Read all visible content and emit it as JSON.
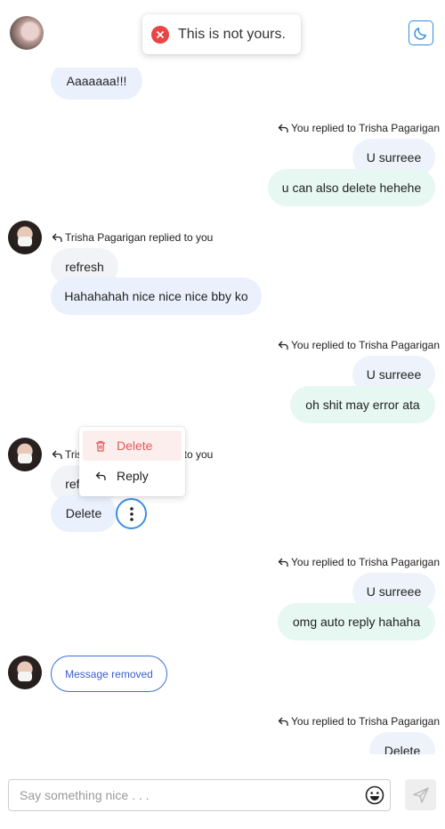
{
  "toast": {
    "text": "This is not yours."
  },
  "feed": {
    "top_partial_bubble": "Aaaaaaa!!!",
    "messages": [
      {
        "reply_meta": "You replied to Trisha Pagarigan",
        "quoted": "U surreee",
        "text": "u can also delete hehehe"
      },
      {
        "reply_meta": "Trisha Pagarigan replied to you",
        "quoted": "refresh",
        "text": "Hahahahah nice nice nice bby ko"
      },
      {
        "reply_meta": "You replied to Trisha Pagarigan",
        "quoted": "U surreee",
        "text": "oh shit may error ata"
      },
      {
        "reply_meta": "Trisha Pagarigan replied to you",
        "quoted": "refresh",
        "text": "Delete"
      },
      {
        "reply_meta": "You replied to Trisha Pagarigan",
        "quoted": "U surreee",
        "text": "omg auto reply hahaha"
      },
      {
        "text": "Message removed"
      },
      {
        "reply_meta": "You replied to Trisha Pagarigan",
        "quoted": "Delete"
      }
    ]
  },
  "context_menu": {
    "items": [
      {
        "label": "Delete",
        "icon": "trash-icon"
      },
      {
        "label": "Reply",
        "icon": "reply-icon"
      }
    ]
  },
  "composer": {
    "placeholder": "Say something nice . . ."
  },
  "colors": {
    "accent": "#2d8fe0",
    "incoming_bubble": "#eaf1fd",
    "outgoing_bubble": "#e6f8f1",
    "danger": "#e45757",
    "toast_error": "#e84545"
  }
}
